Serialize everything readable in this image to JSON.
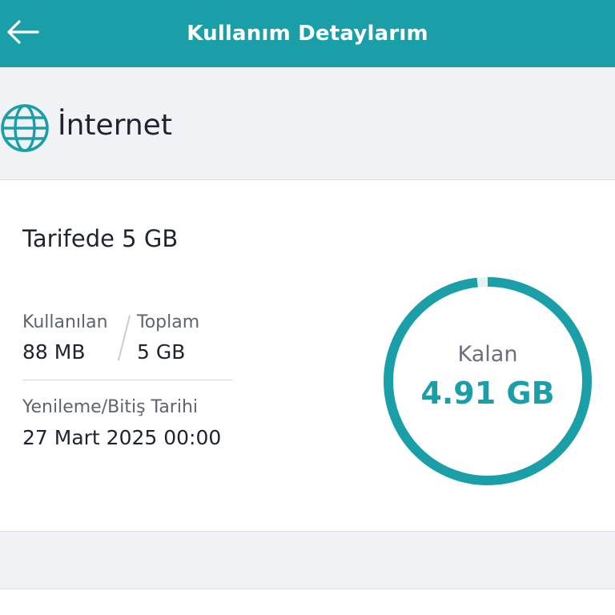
{
  "header": {
    "title": "Kullanım Detaylarım",
    "back_icon": "arrow-left-icon",
    "background": "#1a9fa8"
  },
  "section": {
    "icon": "globe-icon",
    "title": "İnternet"
  },
  "card": {
    "plan_label": "Tarifede 5 GB",
    "used_label": "Kullanılan",
    "used_value": "88 MB",
    "total_label": "Toplam",
    "total_value": "5 GB",
    "renewal_label": "Yenileme/Bitiş Tarihi",
    "renewal_value": "27 Mart 2025 00:00",
    "remaining_label": "Kalan",
    "remaining_value": "4.91 GB",
    "remaining_fraction": 0.983,
    "accent": "#1a9fa8"
  }
}
